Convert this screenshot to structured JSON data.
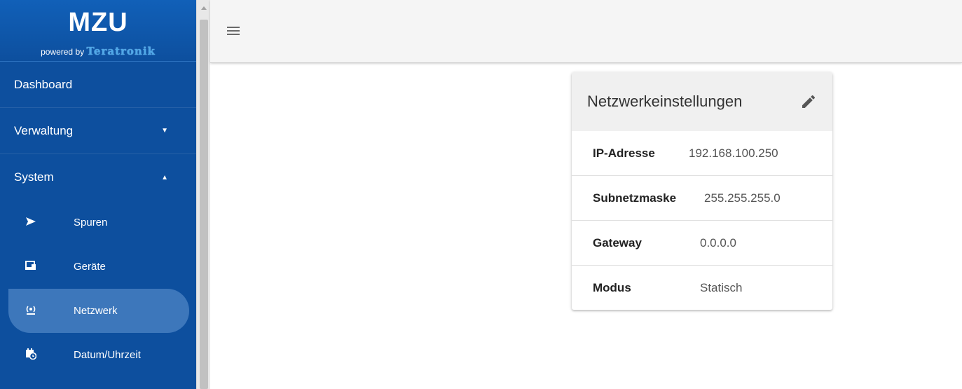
{
  "brand": {
    "title": "MZU",
    "powered_by": "powered by",
    "company": "Teratronik"
  },
  "nav": {
    "dashboard": "Dashboard",
    "verwaltung": "Verwaltung",
    "system": "System",
    "sub_items": [
      {
        "label": "Spuren",
        "icon": "send-icon"
      },
      {
        "label": "Geräte",
        "icon": "devices-icon"
      },
      {
        "label": "Netzwerk",
        "icon": "network-icon",
        "active": true
      },
      {
        "label": "Datum/Uhrzeit",
        "icon": "calendar-clock-icon"
      }
    ]
  },
  "card": {
    "title": "Netzwerkeinstellungen",
    "rows": [
      {
        "label": "IP-Adresse",
        "value": "192.168.100.250"
      },
      {
        "label": "Subnetzmaske",
        "value": "255.255.255.0"
      },
      {
        "label": "Gateway",
        "value": "0.0.0.0"
      },
      {
        "label": "Modus",
        "value": "Statisch"
      }
    ]
  },
  "colors": {
    "sidebar": "#0d4f9e",
    "active_item": "#3d77bb",
    "topbar": "#f5f5f5",
    "card_header": "#f0f0f0"
  }
}
